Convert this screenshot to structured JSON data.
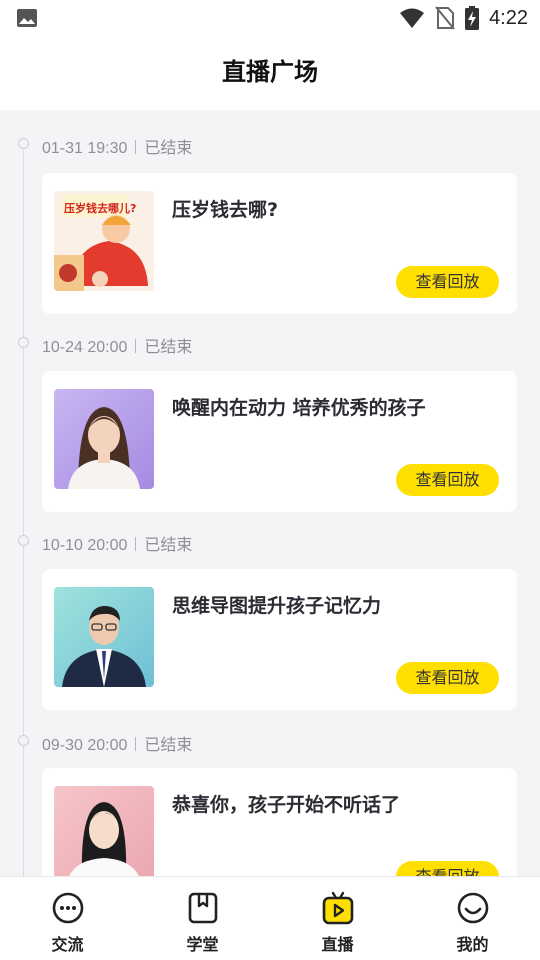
{
  "status_bar": {
    "time": "4:22",
    "icons": [
      "image-icon",
      "wifi-icon",
      "no-sim-icon",
      "battery-charging-icon"
    ]
  },
  "header": {
    "title": "直播广场"
  },
  "sessions": [
    {
      "date": "01-31 19:30",
      "status": "已结束",
      "title": "压岁钱去哪?",
      "button": "查看回放",
      "thumb_text": "压岁钱去哪儿?"
    },
    {
      "date": "10-24 20:00",
      "status": "已结束",
      "title": "唤醒内在动力 培养优秀的孩子",
      "button": "查看回放"
    },
    {
      "date": "10-10 20:00",
      "status": "已结束",
      "title": "思维导图提升孩子记忆力",
      "button": "查看回放"
    },
    {
      "date": "09-30 20:00",
      "status": "已结束",
      "title": "恭喜你，孩子开始不听话了",
      "button": "查看回放"
    }
  ],
  "bottom_nav": [
    {
      "label": "交流",
      "icon": "chat-bubble-icon",
      "active": false
    },
    {
      "label": "学堂",
      "icon": "bookmark-book-icon",
      "active": false
    },
    {
      "label": "直播",
      "icon": "live-tv-icon",
      "active": true
    },
    {
      "label": "我的",
      "icon": "smiley-profile-icon",
      "active": false
    }
  ],
  "colors": {
    "accent": "#ffdf00",
    "background": "#f4f4f6",
    "text_dark": "#2b2b33",
    "text_muted": "#8f8f98"
  }
}
